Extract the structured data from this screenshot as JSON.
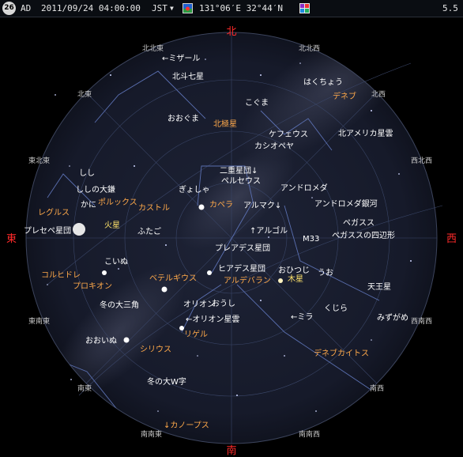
{
  "app": {
    "badge_label": "26",
    "era": "AD",
    "datetime": "2011/09/24 04:00:00",
    "timezone": "JST",
    "location": "131°06′E 32°44′N",
    "magnitude": "5.5"
  },
  "colors": {
    "sky_disc": "#15192a",
    "direction_main": "#ff2a2a",
    "direction_sub": "#c8c8c8",
    "label_white": "#ffffff",
    "label_orange": "#ffa94a",
    "label_yellow": "#ffe36b"
  },
  "directions": {
    "north": "北",
    "south": "南",
    "east": "東",
    "west": "西",
    "nne": "北北東",
    "nnw": "北北西",
    "ne": "北東",
    "nw": "北西",
    "ene": "東北東",
    "wnw": "西北西",
    "ese": "東南東",
    "wsw": "西南西",
    "se": "南東",
    "sw": "南西",
    "sse": "南南東",
    "ssw": "南南西"
  },
  "labels": {
    "mizar": "←ミザール",
    "big_dipper": "北斗七星",
    "ursa_major": "おおぐま",
    "polaris": "北極星",
    "cygnus_lbl": "はくちょう",
    "deneb": "デネブ",
    "ursa_minor": "こぐま",
    "cepheus": "ケフェウス",
    "north_america": "北アメリカ星雲",
    "cassiopeia": "カシオペヤ",
    "double_cluster": "二重星団↓",
    "perseus": "ペルセウス",
    "andromeda": "アンドロメダ",
    "auriga": "ぎょしゃ",
    "capella": "カペラ",
    "leo": "しし",
    "sickle": "ししの大鎌",
    "cancer": "かに",
    "pollux": "ポルックス",
    "castor": "カストル",
    "almach": "アルマク↓",
    "andromeda_galaxy": "アンドロメダ銀河",
    "pegasus": "ペガスス",
    "great_square": "ペガススの四辺形",
    "regulus": "レグルス",
    "praesepe": "プレセペ星団",
    "mars": "火星",
    "gemini": "ふたご",
    "algol": "↑アルゴル",
    "m33": "M33",
    "pleiades": "プレアデス星団",
    "canis_minor": "こいぬ",
    "aries": "おひつじ",
    "jupiter": "木星",
    "pisces": "うお",
    "hyades": "ヒアデス星団",
    "aldebaran": "アルデバラン",
    "procyon_label": "コルヒドレ",
    "procyon": "プロキオン",
    "betelgeuse": "ベテルギウス",
    "uranus": "天王星",
    "winter_triangle": "冬の大三角",
    "orion": "オリオン",
    "taurus": "おうし",
    "cetus": "くじら",
    "orion_nebula": "←オリオン星雲",
    "mira": "←ミラ",
    "aquarius": "みずがめ",
    "canis_major": "おおいぬ",
    "rigel": "リゲル",
    "sirius": "シリウス",
    "deneb_kaitos": "デネブカイトス",
    "winter_w": "冬の大W字",
    "canopus": "↓カノープス"
  }
}
